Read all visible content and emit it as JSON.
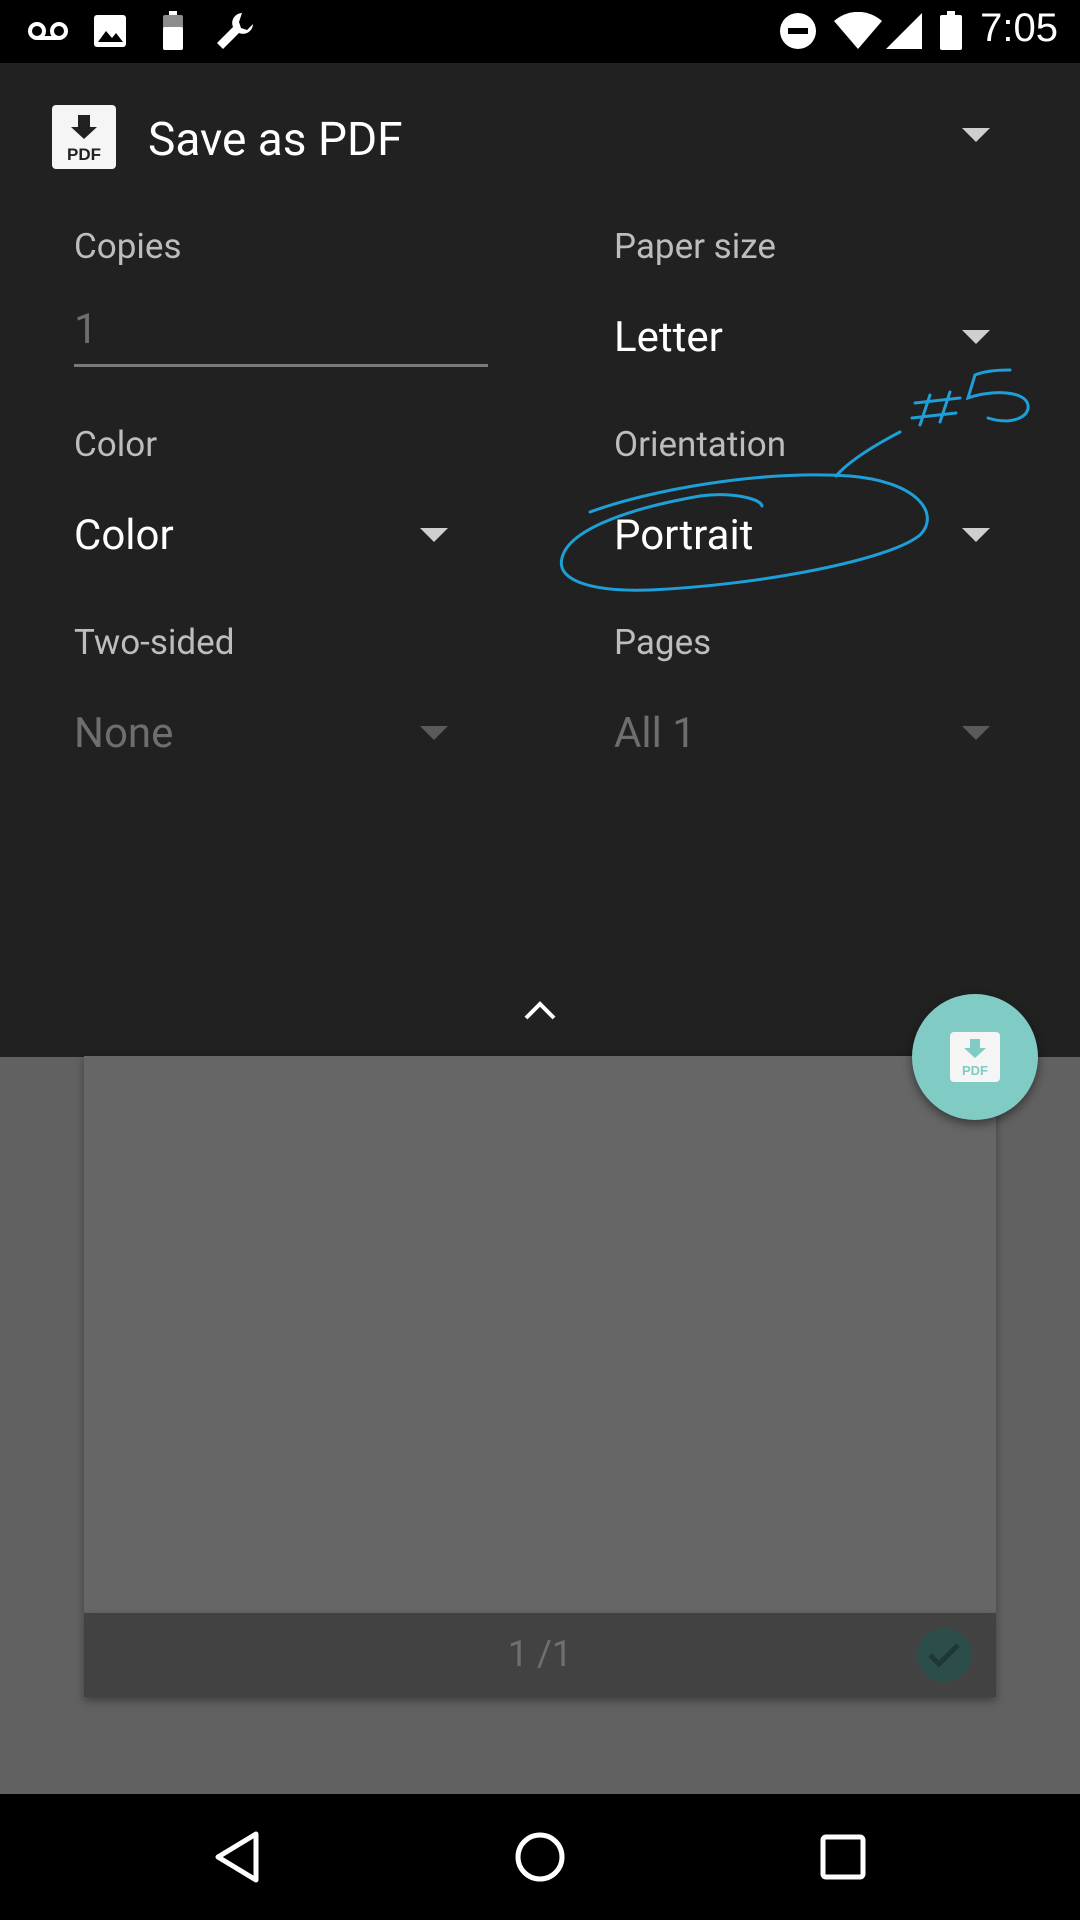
{
  "status_bar": {
    "time": "7:05",
    "left_icons": [
      "voicemail-icon",
      "image-icon",
      "battery-saver-icon",
      "wrench-icon"
    ],
    "right_icons": [
      "do-not-disturb-icon",
      "wifi-icon",
      "signal-icon",
      "battery-icon"
    ]
  },
  "printer": {
    "name": "Save as PDF",
    "icon": "pdf-download-icon",
    "icon_text": "PDF"
  },
  "fields": {
    "copies": {
      "label": "Copies",
      "value": "1"
    },
    "paper_size": {
      "label": "Paper size",
      "value": "Letter"
    },
    "color": {
      "label": "Color",
      "value": "Color"
    },
    "orientation": {
      "label": "Orientation",
      "value": "Portrait"
    },
    "two_sided": {
      "label": "Two-sided",
      "value": "None"
    },
    "pages": {
      "label": "Pages",
      "value": "All 1"
    }
  },
  "preview": {
    "page_number": "1 /1"
  },
  "fab": {
    "icon_text": "PDF"
  },
  "annotation": {
    "text": "#5",
    "color": "#1e9fd8"
  },
  "colors": {
    "panel": "#212121",
    "fab": "#80cbc4",
    "preview_bg": "#616161"
  }
}
